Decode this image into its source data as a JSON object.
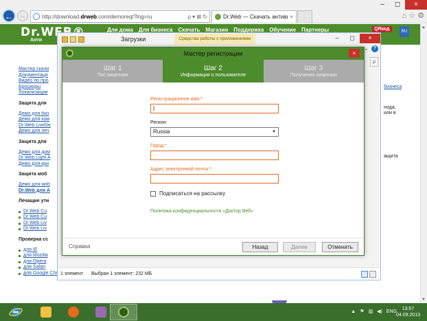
{
  "browser": {
    "address_url": "http://download.",
    "address_domain": "drweb",
    "address_rest": ".com/demoreq/?lng=ru",
    "address_tools": "ρ ▾ ⊠ ↻",
    "tab_title": "Dr.Web — Скачать антиви...",
    "tab_close": "×",
    "window_min": "–",
    "window_max": "◻",
    "window_close": "×",
    "back_glyph": "←",
    "forward_glyph": "→",
    "tools_icons": "⌂ ☆ ⚙"
  },
  "site": {
    "logo": "Dr.WEB®",
    "logo_sub": "Анти",
    "nav": [
      "Для дома",
      "Для бизнеса",
      "Скачать",
      "Магазин",
      "Поддержка",
      "Обучение",
      "Партнеры"
    ],
    "badge": "QRкод",
    "badge_sub": "Web",
    "badge2": "RU",
    "left_items": [
      {
        "type": "lnk",
        "text": "Мастер скачи"
      },
      {
        "type": "lnk",
        "text": "Документаци"
      },
      {
        "type": "lnk",
        "text": "Видео по про"
      },
      {
        "type": "lnk",
        "text": "Брошюры"
      },
      {
        "type": "lnk",
        "text": "Локализации"
      },
      {
        "type": "hd",
        "text": "Защита для"
      },
      {
        "type": "lnk",
        "text": "Демо для биз"
      },
      {
        "type": "lnk",
        "text": "Демо для ком"
      },
      {
        "type": "lnk",
        "text": "Dr.Web LiveDe"
      },
      {
        "type": "lnk",
        "text": "Демо для леч"
      },
      {
        "type": "hd",
        "text": "Защита для"
      },
      {
        "type": "lnk",
        "text": "Демо для дом"
      },
      {
        "type": "lnk",
        "text": "Dr.Web Light A"
      },
      {
        "type": "lnk",
        "text": "Демо для кри"
      },
      {
        "type": "hd",
        "text": "Защита моб"
      },
      {
        "type": "lnk",
        "text": "Демо для моб"
      },
      {
        "type": "bold",
        "text": "Dr.Web для А"
      },
      {
        "type": "hd",
        "text": "Лечащие ути"
      },
      {
        "type": "bul",
        "text": "Dr.Web Cu"
      },
      {
        "type": "bul",
        "text": "Dr.Web Cu"
      },
      {
        "type": "bul",
        "text": "Dr.Web Liv"
      },
      {
        "type": "bul",
        "text": "Dr.Web Liv"
      },
      {
        "type": "hd",
        "text": "Проверка сс"
      },
      {
        "type": "bul",
        "text": "для IE"
      },
      {
        "type": "bul",
        "text": "для Mozilla"
      },
      {
        "type": "bul",
        "text": "для Opera"
      },
      {
        "type": "bul",
        "text": "для Safari"
      },
      {
        "type": "bul",
        "text": "для Google Chrome"
      }
    ],
    "right_link": "бизнеса",
    "right_text1": "нода,",
    "right_text2": "или в",
    "right_text3": "ащита"
  },
  "explorer": {
    "title": "Загрузки",
    "ribbon_tab": "Средства работы с приложениями",
    "status_count": "1 элемент",
    "status_selected": "Выбран 1 элемент: 232 МБ",
    "help": "?",
    "search_glyph": "ρ",
    "chevron": "⌄",
    "min": "–",
    "max": "◻",
    "close": "×"
  },
  "wizard": {
    "title": "Мастер регистрации",
    "close": "×",
    "steps": [
      {
        "num": "Шаг 1",
        "sub": "Тип лицензии",
        "active": false
      },
      {
        "num": "Шаг 2",
        "sub": "Информация о пользователе",
        "active": true
      },
      {
        "num": "Шаг 3",
        "sub": "Получение лицензии",
        "active": false
      }
    ],
    "reg_name_label": "Регистрационное имя:",
    "reg_name_value": "|",
    "region_label": "Регион:",
    "region_value": "Russia",
    "city_label": "Город:",
    "city_value": "",
    "email_label": "Адрес электронной почты:",
    "email_value": "",
    "required_mark": "*",
    "subscribe_label": "Подписаться на рассылку",
    "subscribe_checked": false,
    "policy_link": "Политика конфиденциальности «Доктор Веб»",
    "help_link": "Справка",
    "back_button": "Назад",
    "next_button": "Далее",
    "cancel_button": "Отменить"
  },
  "taskbar": {
    "tray_arrow": "▲",
    "lang": "ENG",
    "time": "13:57",
    "date": "04.09.2013",
    "colors": {
      "start": "#1e90d8",
      "explorer": "#f1c040",
      "firefox": "#e66b1a",
      "winrar": "#9b6bb0",
      "drweb": "#2f5e14"
    }
  }
}
